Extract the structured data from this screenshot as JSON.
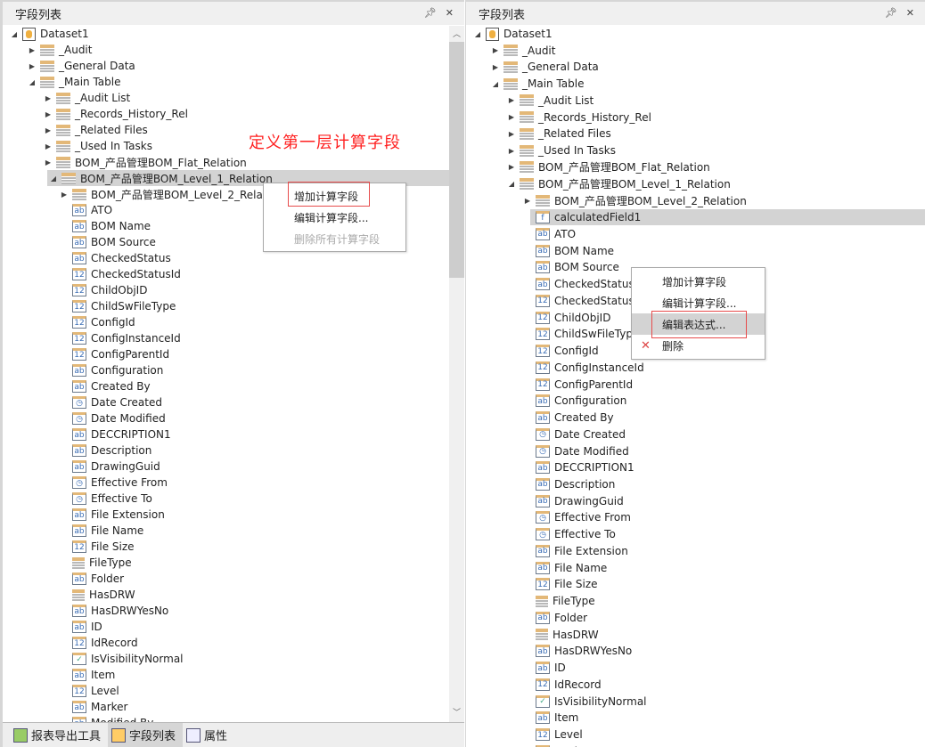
{
  "left_panel": {
    "title": "字段列表",
    "pin_icon": "pin-icon",
    "close_icon": "close-icon",
    "annotation": "定义第一层计算字段",
    "context_menu": {
      "items": [
        "增加计算字段",
        "编辑计算字段...",
        "删除所有计算字段"
      ],
      "disabled": [
        2
      ],
      "highlighted_boxed": 0
    },
    "bottom_tabs": [
      {
        "label": "报表导出工具",
        "icon": "report-export-icon"
      },
      {
        "label": "字段列表",
        "icon": "field-list-icon",
        "active": true
      },
      {
        "label": "属性",
        "icon": "properties-icon"
      }
    ]
  },
  "right_panel": {
    "title": "字段列表",
    "pin_icon": "pin-icon",
    "close_icon": "close-icon",
    "context_menu": {
      "items": [
        "增加计算字段",
        "编辑计算字段...",
        "编辑表达式...",
        "删除"
      ],
      "highlighted_boxed": 2,
      "delete_icon": "x-icon"
    }
  },
  "tree_header": [
    {
      "label": "Dataset1",
      "level": 0,
      "icon": "db",
      "exp": "open"
    },
    {
      "label": "_Audit",
      "level": 1,
      "icon": "tbl",
      "exp": "closed"
    },
    {
      "label": "_General Data",
      "level": 1,
      "icon": "tbl",
      "exp": "closed"
    },
    {
      "label": "_Main Table",
      "level": 1,
      "icon": "tbl",
      "exp": "open"
    },
    {
      "label": "_Audit List",
      "level": 2,
      "icon": "tbl",
      "exp": "closed"
    },
    {
      "label": "_Records_History_Rel",
      "level": 2,
      "icon": "tbl",
      "exp": "closed"
    },
    {
      "label": "_Related Files",
      "level": 2,
      "icon": "tbl",
      "exp": "closed"
    },
    {
      "label": "_Used In Tasks",
      "level": 2,
      "icon": "tbl",
      "exp": "closed"
    },
    {
      "label": "BOM_产品管理BOM_Flat_Relation",
      "level": 2,
      "icon": "tbl",
      "exp": "closed"
    },
    {
      "label": "BOM_产品管理BOM_Level_1_Relation",
      "level": 2,
      "icon": "tbl",
      "exp": "open",
      "selected_left": true
    },
    {
      "label": "BOM_产品管理BOM_Level_2_Relation",
      "level": 3,
      "icon": "tbl",
      "exp": "closed"
    }
  ],
  "calculated_field": {
    "label": "calculatedField1",
    "icon": "f"
  },
  "fields": [
    [
      "ATO",
      "ab"
    ],
    [
      "BOM Name",
      "ab"
    ],
    [
      "BOM Source",
      "ab"
    ],
    [
      "CheckedStatus",
      "ab"
    ],
    [
      "CheckedStatusId",
      "12"
    ],
    [
      "ChildObjID",
      "12"
    ],
    [
      "ChildSwFileType",
      "12"
    ],
    [
      "ConfigId",
      "12"
    ],
    [
      "ConfigInstanceId",
      "12"
    ],
    [
      "ConfigParentId",
      "12"
    ],
    [
      "Configuration",
      "ab"
    ],
    [
      "Created By",
      "ab"
    ],
    [
      "Date Created",
      "clock"
    ],
    [
      "Date Modified",
      "clock"
    ],
    [
      "DECCRIPTION1",
      "ab"
    ],
    [
      "Description",
      "ab"
    ],
    [
      "DrawingGuid",
      "ab"
    ],
    [
      "Effective From",
      "clock"
    ],
    [
      "Effective To",
      "clock"
    ],
    [
      "File Extension",
      "ab"
    ],
    [
      "File Name",
      "ab"
    ],
    [
      "File Size",
      "12"
    ],
    [
      "FileType",
      "grid"
    ],
    [
      "Folder",
      "ab"
    ],
    [
      "HasDRW",
      "grid"
    ],
    [
      "HasDRWYesNo",
      "ab"
    ],
    [
      "ID",
      "ab"
    ],
    [
      "IdRecord",
      "12"
    ],
    [
      "IsVisibilityNormal",
      "check"
    ],
    [
      "Item",
      "ab"
    ],
    [
      "Level",
      "12"
    ],
    [
      "Marker",
      "ab"
    ],
    [
      "Modified By",
      "ab"
    ]
  ],
  "colors": {
    "selection": "#d3d3d3",
    "highlight_box": "#e74c4c",
    "annotation": "#ff2020"
  }
}
